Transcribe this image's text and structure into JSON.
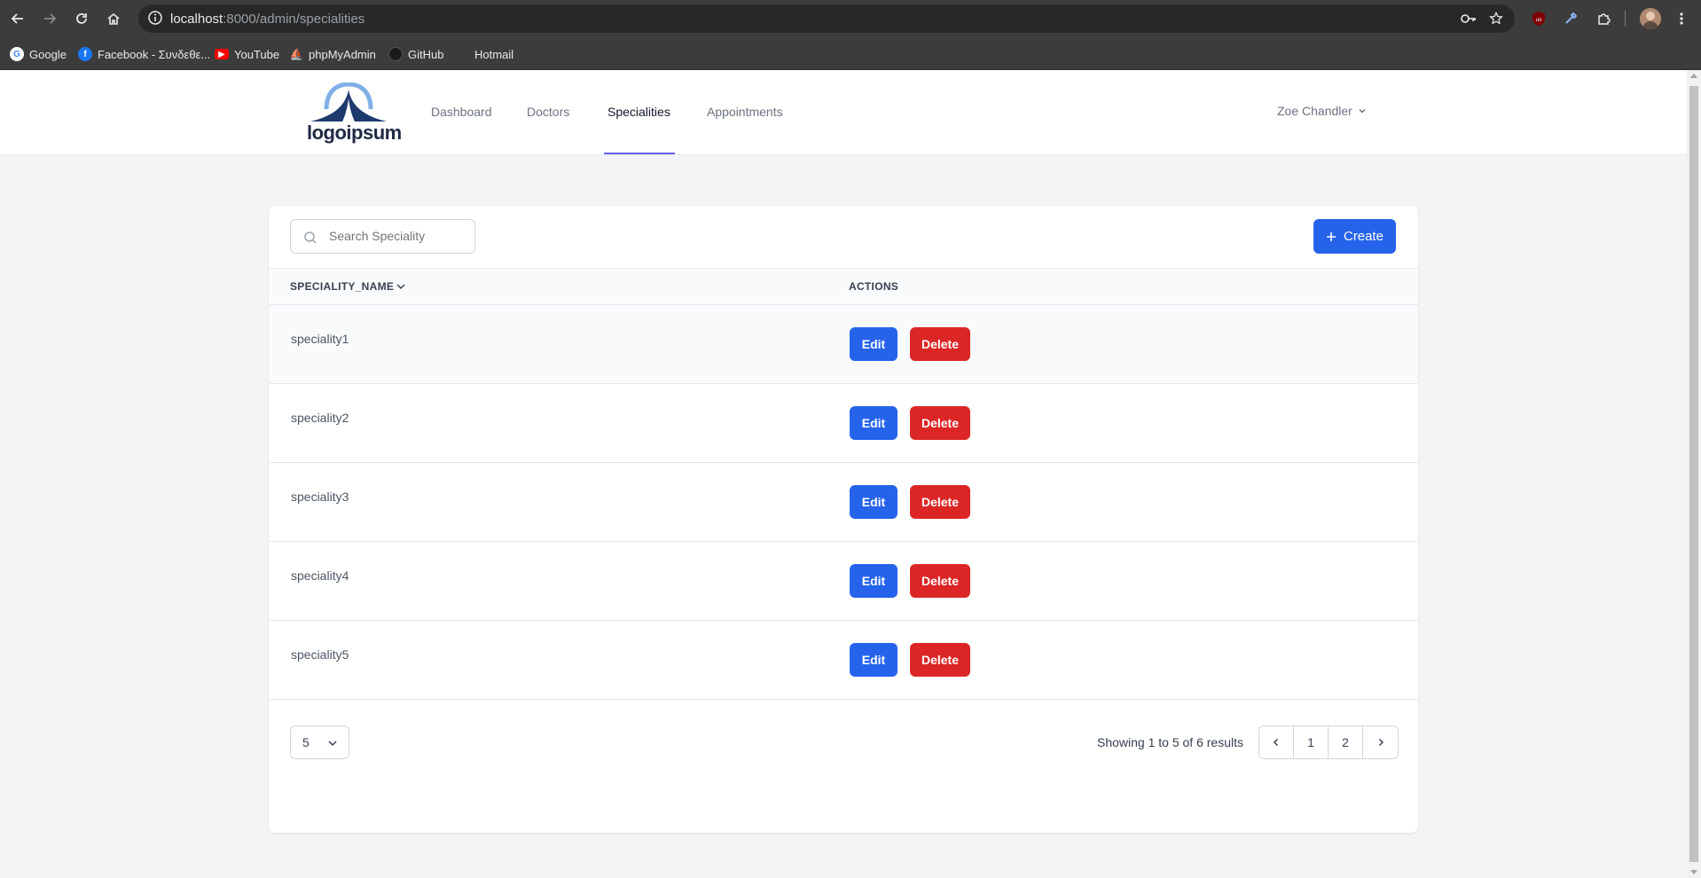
{
  "browser": {
    "url_host": "localhost",
    "url_path": ":8000/admin/specialities",
    "bookmarks": [
      {
        "label": "Google"
      },
      {
        "label": "Facebook - Συνδεθε..."
      },
      {
        "label": "YouTube"
      },
      {
        "label": "phpMyAdmin"
      },
      {
        "label": "GitHub"
      },
      {
        "label": "Hotmail"
      }
    ]
  },
  "header": {
    "logo_text": "logoipsum",
    "nav": [
      {
        "label": "Dashboard",
        "active": false
      },
      {
        "label": "Doctors",
        "active": false
      },
      {
        "label": "Specialities",
        "active": true
      },
      {
        "label": "Appointments",
        "active": false
      }
    ],
    "user_name": "Zoe Chandler"
  },
  "toolbar": {
    "search_placeholder": "Search Speciality",
    "create_label": "Create"
  },
  "table": {
    "columns": [
      "SPECIALITY_NAME",
      "ACTIONS"
    ],
    "rows": [
      {
        "name": "speciality1"
      },
      {
        "name": "speciality2"
      },
      {
        "name": "speciality3"
      },
      {
        "name": "speciality4"
      },
      {
        "name": "speciality5"
      }
    ],
    "edit_label": "Edit",
    "delete_label": "Delete"
  },
  "pagination": {
    "per_page": "5",
    "summary": "Showing 1 to 5 of 6 results",
    "pages": [
      "1",
      "2"
    ]
  },
  "colors": {
    "primary": "#2563eb",
    "danger": "#dc2626",
    "active_underline": "#6366f1"
  }
}
